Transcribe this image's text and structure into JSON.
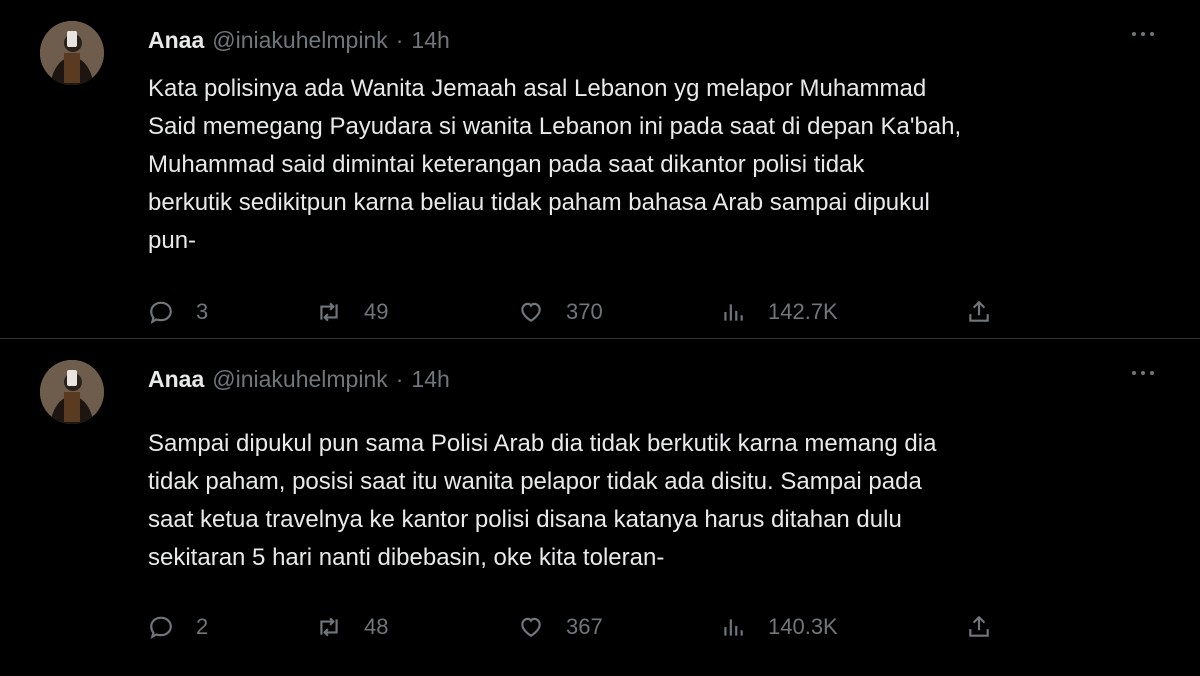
{
  "tweets": [
    {
      "name": "Anaa",
      "handle": "@iniakuhelmpink",
      "separator": "·",
      "time": "14h",
      "text": "Kata polisinya ada Wanita Jemaah asal Lebanon yg melapor Muhammad\nSaid memegang Payudara si wanita Lebanon ini pada saat di depan Ka'bah,\nMuhammad said dimintai keterangan pada saat dikantor polisi tidak\nberkutik sedikitpun karna beliau tidak paham bahasa Arab sampai dipukul\npun-",
      "replies": "3",
      "retweets": "49",
      "likes": "370",
      "views": "142.7K"
    },
    {
      "name": "Anaa",
      "handle": "@iniakuhelmpink",
      "separator": "·",
      "time": "14h",
      "text": "Sampai dipukul pun sama Polisi Arab dia tidak berkutik karna memang dia\ntidak paham, posisi saat itu wanita pelapor tidak ada disitu. Sampai pada\nsaat ketua travelnya ke kantor polisi disana katanya harus ditahan dulu\nsekitaran 5 hari nanti dibebasin, oke kita toleran-",
      "replies": "2",
      "retweets": "48",
      "likes": "367",
      "views": "140.3K"
    }
  ],
  "colors": {
    "background": "#000000",
    "text": "#e7e9ea",
    "secondary": "#71767b",
    "divider": "#2f3336"
  },
  "icons": {
    "reply": "reply-icon",
    "retweet": "retweet-icon",
    "like": "heart-icon",
    "views": "views-icon",
    "share": "share-icon",
    "more": "more-icon"
  }
}
